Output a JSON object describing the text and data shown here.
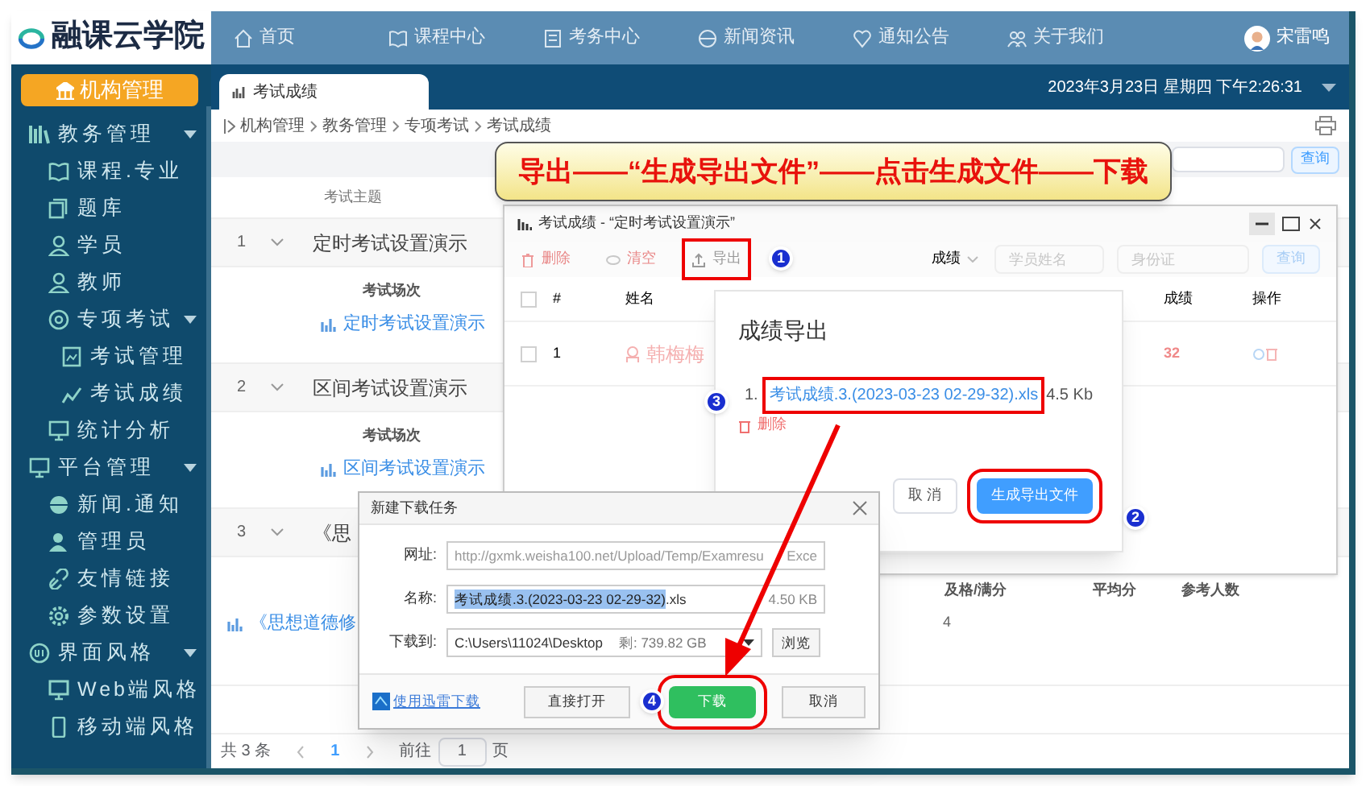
{
  "logo": {
    "text": "融课云学院"
  },
  "nav": [
    {
      "label": "首页"
    },
    {
      "label": "课程中心"
    },
    {
      "label": "考务中心"
    },
    {
      "label": "新闻资讯"
    },
    {
      "label": "通知公告"
    },
    {
      "label": "关于我们"
    }
  ],
  "user": {
    "name": "宋雷鸣"
  },
  "org_button": "机构管理",
  "sidebar": [
    {
      "label": "教务管理",
      "expanded": true,
      "children": [
        {
          "label": "课程.专业"
        },
        {
          "label": "题库"
        },
        {
          "label": "学员"
        },
        {
          "label": "教师"
        },
        {
          "label": "专项考试",
          "expanded": true,
          "children": [
            {
              "label": "考试管理"
            },
            {
              "label": "考试成绩"
            }
          ]
        },
        {
          "label": "统计分析"
        }
      ]
    },
    {
      "label": "平台管理",
      "expanded": true,
      "children": [
        {
          "label": "新闻.通知"
        },
        {
          "label": "管理员"
        },
        {
          "label": "友情链接"
        },
        {
          "label": "参数设置"
        }
      ]
    },
    {
      "label": "界面风格",
      "expanded": true,
      "children": [
        {
          "label": "Web端风格"
        },
        {
          "label": "移动端风格"
        }
      ]
    }
  ],
  "datetime": "2023年3月23日 星期四 下午2:26:31",
  "tab": {
    "label": "考试成绩"
  },
  "breadcrumb": [
    "机构管理",
    "教务管理",
    "专项考试",
    "考试成绩"
  ],
  "query_button": "查询",
  "exam_table": {
    "column": "考试主题",
    "rows": [
      {
        "index": "1",
        "title": "定时考试设置演示",
        "sub_heading": "考试场次",
        "session": "定时考试设置演示"
      },
      {
        "index": "2",
        "title": "区间考试设置演示",
        "sub_heading": "考试场次",
        "session": "区间考试设置演示"
      },
      {
        "index": "3",
        "title": "《思",
        "session": "《思想道德修",
        "stats_columns": [
          "及格/满分",
          "平均分",
          "参考人数"
        ],
        "stats_value": "4"
      }
    ]
  },
  "pagination": {
    "total": "共 3 条",
    "page": "1",
    "goto_label": "前往",
    "goto_value": "1",
    "page_suffix": "页"
  },
  "annotation": "导出——“生成导出文件”——点击生成文件——下载",
  "results_window": {
    "title": "考试成绩 - “定时考试设置演示”",
    "toolbar": [
      "删除",
      "清空",
      "导出"
    ],
    "filter": "成绩",
    "name_placeholder": "学员姓名",
    "id_placeholder": "身份证",
    "query": "查询",
    "columns": [
      "#",
      "姓名",
      "成绩",
      "操作"
    ],
    "all_checked": false,
    "rows": [
      {
        "index": "1",
        "name": "韩梅梅",
        "score": "32",
        "checked": false
      }
    ]
  },
  "export_dialog": {
    "title": "成绩导出",
    "files": [
      {
        "index": "1.",
        "name": "考试成绩.3.(2023-03-23 02-29-32).xls",
        "size": "4.5 Kb"
      }
    ],
    "delete": "删除",
    "cancel": "取 消",
    "generate": "生成导出文件"
  },
  "download_dialog": {
    "title": "新建下载任务",
    "url_label": "网址:",
    "url": "http://gxmk.weisha100.net/Upload/Temp/Examresu",
    "url_tail": "Exce",
    "name_label": "名称:",
    "filename": "考试成绩.3.(2023-03-23 02-29-32)",
    "extension": ".xls",
    "size": "4.50 KB",
    "dir_label": "下载到:",
    "dir": "C:\\Users\\11024\\Desktop",
    "free": "剩: 739.82 GB",
    "browse": "浏览",
    "thunder": "使用迅雷下载",
    "open": "直接打开",
    "download": "下载",
    "cancel": "取消"
  },
  "steps": [
    "1",
    "2",
    "3",
    "4"
  ]
}
